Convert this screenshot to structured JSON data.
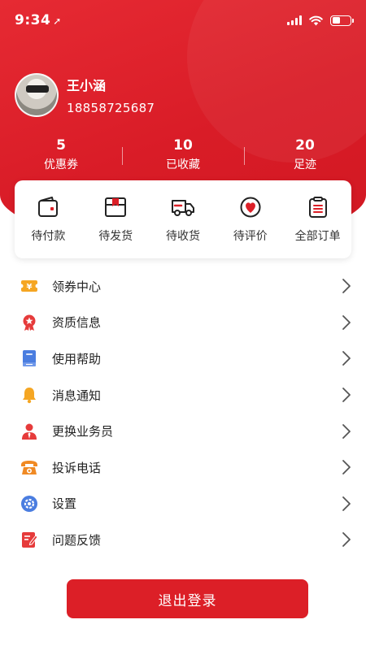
{
  "status_bar": {
    "time": "9:34",
    "location_icon": "location-arrow-icon",
    "battery_level": 0.45
  },
  "profile": {
    "name": "王小涵",
    "phone": "18858725687",
    "avatar_icon": "avatar"
  },
  "stats": [
    {
      "count": "5",
      "label": "优惠券"
    },
    {
      "count": "10",
      "label": "已收藏"
    },
    {
      "count": "20",
      "label": "足迹"
    }
  ],
  "orders": [
    {
      "label": "待付款",
      "icon": "wallet-icon"
    },
    {
      "label": "待发货",
      "icon": "package-icon"
    },
    {
      "label": "待收货",
      "icon": "delivery-truck-icon"
    },
    {
      "label": "待评价",
      "icon": "review-icon"
    },
    {
      "label": "全部订单",
      "icon": "order-list-icon"
    }
  ],
  "menu": [
    {
      "label": "领券中心",
      "icon": "coupon-icon"
    },
    {
      "label": "资质信息",
      "icon": "certificate-icon"
    },
    {
      "label": "使用帮助",
      "icon": "help-book-icon"
    },
    {
      "label": "消息通知",
      "icon": "bell-icon"
    },
    {
      "label": "更换业务员",
      "icon": "salesperson-icon"
    },
    {
      "label": "投诉电话",
      "icon": "phone-icon"
    },
    {
      "label": "设置",
      "icon": "settings-icon"
    },
    {
      "label": "问题反馈",
      "icon": "feedback-icon"
    }
  ],
  "logout_label": "退出登录",
  "colors": {
    "brand_red": "#dc1f27",
    "header_red": "#e62a33",
    "icon_gold": "#f5a623",
    "icon_blue": "#4a7de0"
  }
}
